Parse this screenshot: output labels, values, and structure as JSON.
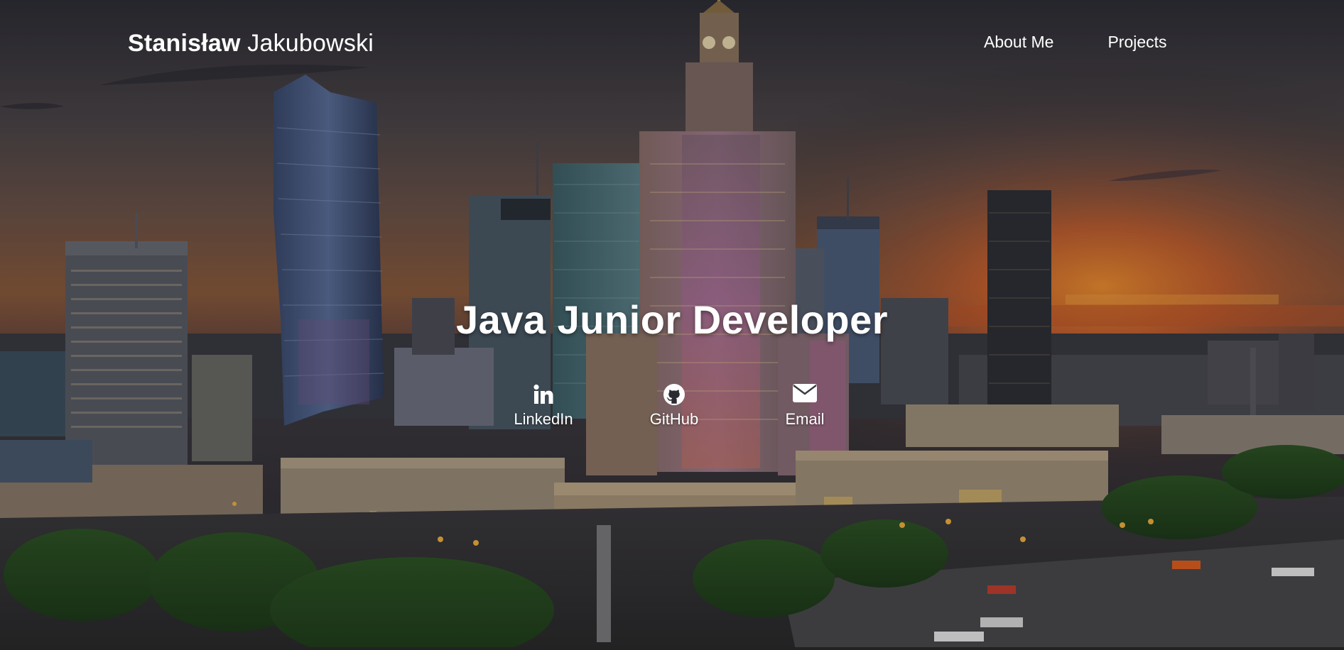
{
  "brand": {
    "first_name": "Stanisław",
    "last_name": "Jakubowski"
  },
  "nav": {
    "items": [
      {
        "label": "About Me"
      },
      {
        "label": "Projects"
      }
    ]
  },
  "hero": {
    "headline": "Java Junior Developer",
    "background": "Warsaw skyline at sunset with Palace of Culture and Science",
    "social": [
      {
        "label": "LinkedIn",
        "icon": "linkedin-icon"
      },
      {
        "label": "GitHub",
        "icon": "github-icon"
      },
      {
        "label": "Email",
        "icon": "envelope-icon"
      }
    ]
  },
  "colors": {
    "text": "#ffffff",
    "sky_top": "#3b3940",
    "sunset": "#e2651e"
  }
}
